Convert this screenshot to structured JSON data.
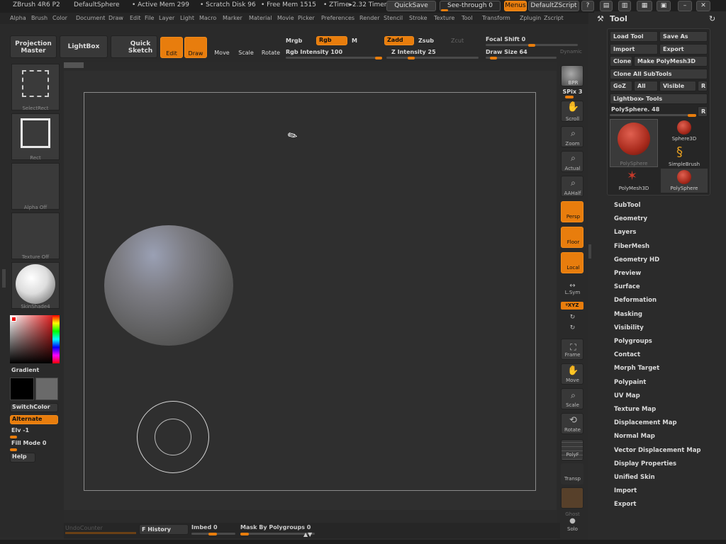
{
  "titlebar": {
    "app": "ZBrush 4R6 P2",
    "doc": "DefaultSphere",
    "active_mem": "• Active Mem 299",
    "scratch": "• Scratch Disk 96",
    "free_mem": "• Free Mem 1515",
    "ztime": "• ZTime▸2.32 Timer",
    "quicksave": "QuickSave",
    "seethrough": "See-through 0",
    "menus": "Menus",
    "zscript": "DefaultZScript"
  },
  "menubar": [
    "Alpha",
    "Brush",
    "Color",
    "Document",
    "Draw",
    "Edit",
    "File",
    "Layer",
    "Light",
    "Macro",
    "Marker",
    "Material",
    "Movie",
    "Picker",
    "Preferences",
    "Render",
    "Stencil",
    "Stroke",
    "Texture",
    "Tool",
    "Transform",
    "Zplugin",
    "Zscript"
  ],
  "topshelf": {
    "projection_master": "Projection Master",
    "lightbox": "LightBox",
    "quick_sketch": "Quick Sketch",
    "edit": "Edit",
    "draw": "Draw",
    "move": "Move",
    "scale": "Scale",
    "rotate": "Rotate",
    "mrgb": "Mrgb",
    "rgb": "Rgb",
    "m": "M",
    "zadd": "Zadd",
    "zsub": "Zsub",
    "zcut": "Zcut",
    "rgb_intensity": "Rgb Intensity 100",
    "z_intensity": "Z Intensity 25",
    "focal_shift": "Focal Shift 0",
    "draw_size": "Draw Size 64",
    "dynamic": "Dynamic",
    "rgb_intensity_value": 100,
    "z_intensity_value": 25,
    "focal_shift_value": 0,
    "draw_size_value": 64
  },
  "leftshelf": {
    "select_rect": "SelectRect",
    "rect": "Rect",
    "alpha_off": "Alpha Off",
    "texture_off": "Texture Off",
    "material": "SkinShade4",
    "gradient": "Gradient",
    "switchcolor": "SwitchColor",
    "alternate": "Alternate",
    "elv": "Elv -1",
    "fill_mode": "Fill Mode 0",
    "help": "Help"
  },
  "rightshelf": {
    "bpr": "BPR",
    "spix": "SPix 3",
    "scroll": "Scroll",
    "zoom": "Zoom",
    "actual": "Actual",
    "aahalf": "AAHalf",
    "persp": "Persp",
    "floor": "Floor",
    "local": "Local",
    "lsym": "L.Sym",
    "xyz": "ᵍXYZ",
    "frame": "Frame",
    "move": "Move",
    "scale": "Scale",
    "rotate": "Rotate",
    "polyf": "PolyF",
    "transp": "Transp",
    "ghost": "Ghost",
    "solo": "Solo"
  },
  "bottombar": {
    "undo": "UndoCounter",
    "history": "F History",
    "imbed": "Imbed 0",
    "mask_polygroups": "Mask By Polygroups 0"
  },
  "toolpalette": {
    "title": "Tool",
    "load_tool": "Load Tool",
    "save_as": "Save As",
    "import": "Import",
    "export": "Export",
    "clone": "Clone",
    "make_polymesh": "Make PolyMesh3D",
    "clone_all": "Clone All SubTools",
    "goz": "GoZ",
    "all": "All",
    "visible": "Visible",
    "r": "R",
    "lightbox_tools": "Lightbox▸ Tools",
    "current_tool": "PolySphere. 48",
    "tools": [
      {
        "name": "PolySphere"
      },
      {
        "name": "Sphere3D"
      },
      {
        "name": "SimpleBrush"
      },
      {
        "name": "PolyMesh3D"
      },
      {
        "name": "PolySphere"
      }
    ],
    "sections": [
      "SubTool",
      "Geometry",
      "Layers",
      "FiberMesh",
      "Geometry HD",
      "Preview",
      "Surface",
      "Deformation",
      "Masking",
      "Visibility",
      "Polygroups",
      "Contact",
      "Morph Target",
      "Polypaint",
      "UV Map",
      "Texture Map",
      "Displacement Map",
      "Normal Map",
      "Vector Displacement Map",
      "Display Properties",
      "Unified Skin",
      "Import",
      "Export"
    ]
  },
  "colors": {
    "accent": "#e87d0d",
    "panel": "#2a2a2a",
    "canvas": "#2f2f2f"
  }
}
